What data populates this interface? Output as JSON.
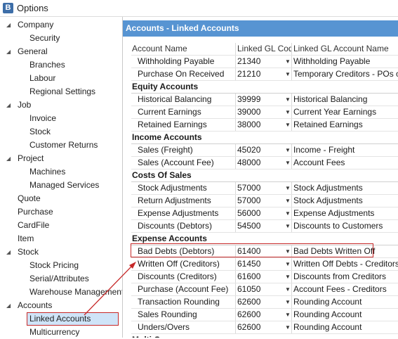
{
  "window": {
    "title": "Options",
    "icon": "app-logo-icon"
  },
  "tree": [
    {
      "label": "Company",
      "level": 0,
      "expanded": true
    },
    {
      "label": "Security",
      "level": 1
    },
    {
      "label": "General",
      "level": 0,
      "expanded": true
    },
    {
      "label": "Branches",
      "level": 1
    },
    {
      "label": "Labour",
      "level": 1
    },
    {
      "label": "Regional Settings",
      "level": 1
    },
    {
      "label": "Job",
      "level": 0,
      "expanded": true
    },
    {
      "label": "Invoice",
      "level": 1
    },
    {
      "label": "Stock",
      "level": 1
    },
    {
      "label": "Customer Returns",
      "level": 1
    },
    {
      "label": "Project",
      "level": 0,
      "expanded": true
    },
    {
      "label": "Machines",
      "level": 1
    },
    {
      "label": "Managed Services",
      "level": 1
    },
    {
      "label": "Quote",
      "level": 0
    },
    {
      "label": "Purchase",
      "level": 0
    },
    {
      "label": "CardFile",
      "level": 0
    },
    {
      "label": "Item",
      "level": 0
    },
    {
      "label": "Stock",
      "level": 0,
      "expanded": true
    },
    {
      "label": "Stock Pricing",
      "level": 1
    },
    {
      "label": "Serial/Attributes",
      "level": 1
    },
    {
      "label": "Warehouse Management",
      "level": 1
    },
    {
      "label": "Accounts",
      "level": 0,
      "expanded": true
    },
    {
      "label": "Linked Accounts",
      "level": 1,
      "selected": true
    },
    {
      "label": "Multicurrency",
      "level": 1
    }
  ],
  "panel": {
    "title": "Accounts - Linked Accounts",
    "columns": [
      "Account Name",
      "Linked GL Code",
      "Linked GL Account Name"
    ],
    "rows": [
      {
        "type": "row",
        "name": "Withholding Payable",
        "code": "21340",
        "account": "Withholding Payable"
      },
      {
        "type": "row",
        "name": "Purchase On Received",
        "code": "21210",
        "account": "Temporary Creditors - POs on Rec"
      },
      {
        "type": "group",
        "name": "Equity Accounts"
      },
      {
        "type": "row",
        "name": "Historical Balancing",
        "code": "39999",
        "account": "Historical Balancing"
      },
      {
        "type": "row",
        "name": "Current Earnings",
        "code": "39000",
        "account": "Current Year Earnings"
      },
      {
        "type": "row",
        "name": "Retained Earnings",
        "code": "38000",
        "account": "Retained Earnings"
      },
      {
        "type": "group",
        "name": "Income Accounts"
      },
      {
        "type": "row",
        "name": "Sales (Freight)",
        "code": "45020",
        "account": "Income - Freight"
      },
      {
        "type": "row",
        "name": "Sales (Account Fee)",
        "code": "48000",
        "account": "Account Fees"
      },
      {
        "type": "group",
        "name": "Costs Of Sales"
      },
      {
        "type": "row",
        "name": "Stock Adjustments",
        "code": "57000",
        "account": "Stock Adjustments"
      },
      {
        "type": "row",
        "name": "Return Adjustments",
        "code": "57000",
        "account": "Stock Adjustments"
      },
      {
        "type": "row",
        "name": "Expense Adjustments",
        "code": "56000",
        "account": "Expense Adjustments"
      },
      {
        "type": "row",
        "name": "Discounts (Debtors)",
        "code": "54500",
        "account": "Discounts to Customers"
      },
      {
        "type": "group",
        "name": "Expense Accounts"
      },
      {
        "type": "row",
        "name": "Bad Debts (Debtors)",
        "code": "61400",
        "account": "Bad Debts Written Off",
        "highlighted": true
      },
      {
        "type": "row",
        "name": "Written Off (Creditors)",
        "code": "61450",
        "account": "Written Off Debts - Creditors"
      },
      {
        "type": "row",
        "name": "Discounts (Creditors)",
        "code": "61600",
        "account": "Discounts from Creditors"
      },
      {
        "type": "row",
        "name": "Purchase (Account Fee)",
        "code": "61050",
        "account": "Account Fees - Creditors"
      },
      {
        "type": "row",
        "name": "Transaction Rounding",
        "code": "62600",
        "account": "Rounding Account"
      },
      {
        "type": "row",
        "name": "Sales Rounding",
        "code": "62600",
        "account": "Rounding Account"
      },
      {
        "type": "row",
        "name": "Unders/Overs",
        "code": "62600",
        "account": "Rounding Account"
      },
      {
        "type": "group",
        "name": "Multi C"
      }
    ]
  },
  "colors": {
    "header_bg": "#5794d2",
    "selection_bg": "#cfe4f8",
    "annotation": "#c62828"
  }
}
